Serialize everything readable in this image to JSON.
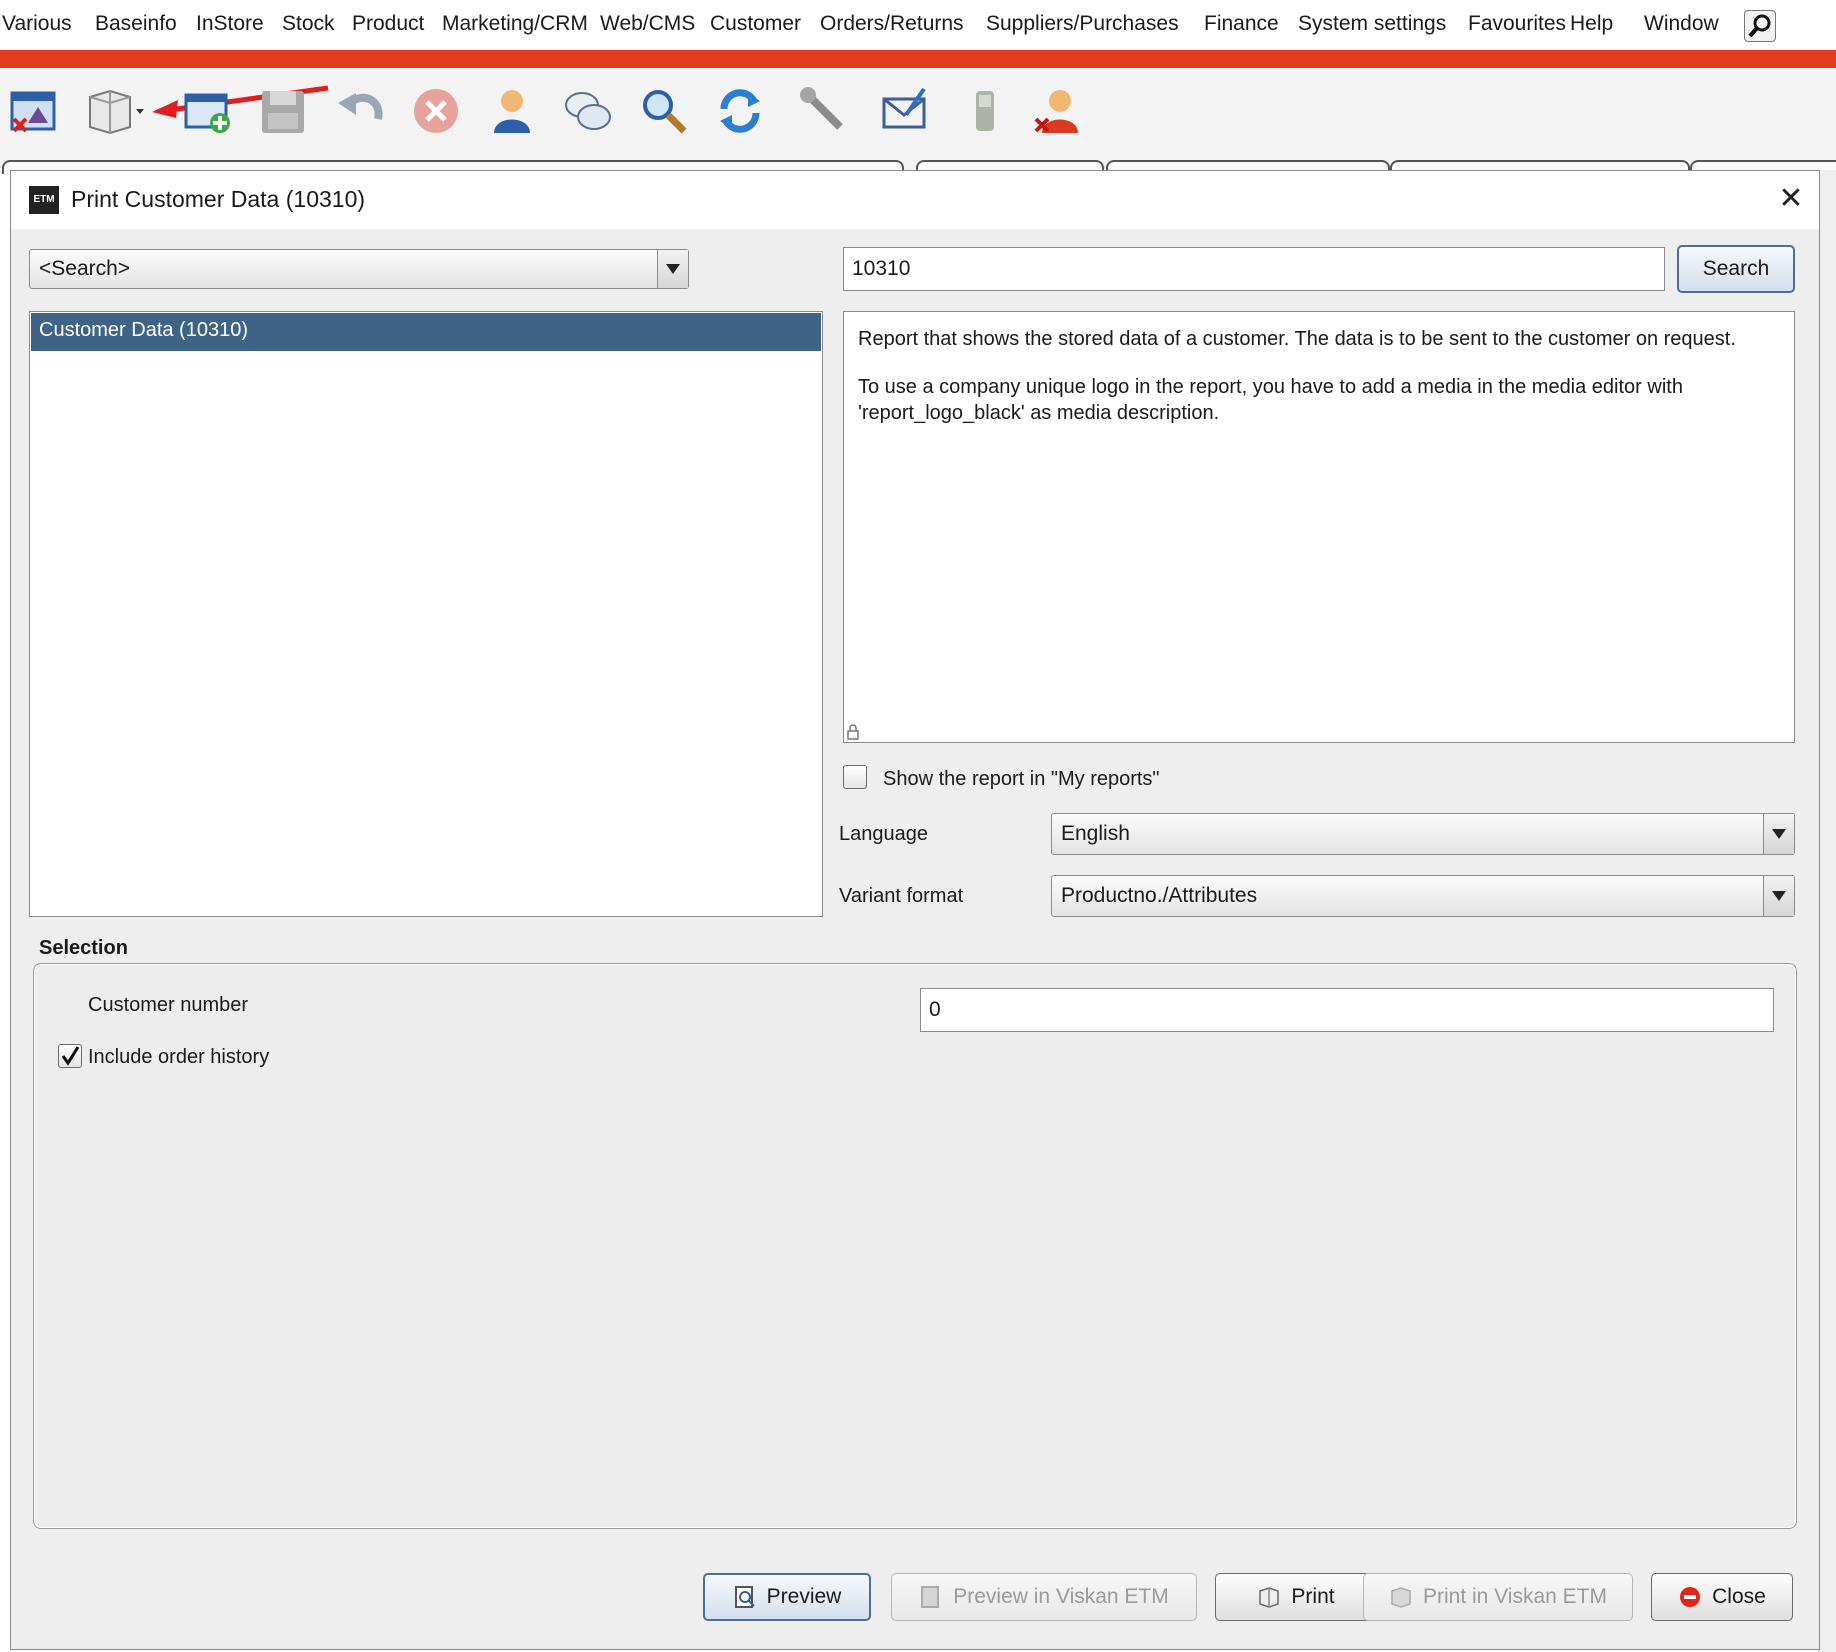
{
  "menu": [
    "Various",
    "Baseinfo",
    "InStore",
    "Stock",
    "Product",
    "Marketing/CRM",
    "Web/CMS",
    "Customer",
    "Orders/Returns",
    "Suppliers/Purchases",
    "Finance",
    "System settings",
    "Favourites",
    "Help",
    "Window"
  ],
  "colors": {
    "accent": "#e63c1e",
    "selection": "#3e6385"
  },
  "toolbar_icons": [
    "close-window-icon",
    "printer-icon",
    "new-window-icon",
    "save-icon",
    "undo-icon",
    "cancel-icon",
    "user-icon",
    "chat-icon",
    "search-icon",
    "refresh-icon",
    "wrench-icon",
    "mail-icon",
    "phone-icon",
    "user-delete-icon"
  ],
  "dialog": {
    "logo": "ETM",
    "title": "Print Customer Data (10310)",
    "search_combo": "<Search>",
    "search_input": "10310",
    "search_button": "Search",
    "list_items": [
      "Customer Data (10310)"
    ],
    "description": [
      "Report that shows the stored data of a customer. The data is to be sent to the customer on request.",
      "To use a company unique logo in the report, you have to add a media in the media editor with 'report_logo_black' as media description."
    ],
    "show_in_my_reports": {
      "label": "Show the report in \"My reports\"",
      "checked": false
    },
    "language": {
      "label": "Language",
      "value": "English"
    },
    "variant_format": {
      "label": "Variant format",
      "value": "Productno./Attributes"
    },
    "selection": {
      "title": "Selection",
      "customer_number_label": "Customer number",
      "customer_number_value": "0",
      "include_order_history": {
        "label": "Include order history",
        "checked": true
      }
    },
    "buttons": {
      "preview": "Preview",
      "preview_viskan": "Preview in Viskan ETM",
      "print": "Print",
      "print_viskan": "Print in Viskan ETM",
      "close": "Close"
    }
  }
}
